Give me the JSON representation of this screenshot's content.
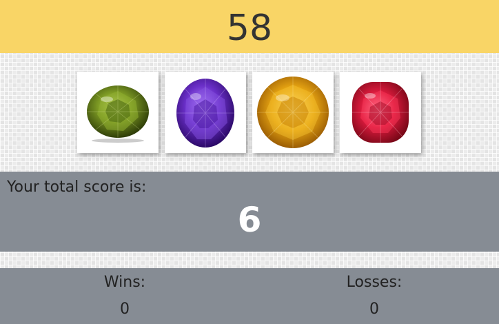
{
  "target": {
    "value": "58"
  },
  "gems": [
    {
      "name": "green-gem-icon",
      "color": "#6b8a1c"
    },
    {
      "name": "purple-gem-icon",
      "color": "#6a2fc8"
    },
    {
      "name": "yellow-gem-icon",
      "color": "#e6a412"
    },
    {
      "name": "red-gem-icon",
      "color": "#d81a3c"
    }
  ],
  "score": {
    "label": "Your total score is:",
    "value": "6"
  },
  "record": {
    "wins_label": "Wins:",
    "wins_value": "0",
    "losses_label": "Losses:",
    "losses_value": "0"
  },
  "colors": {
    "accent": "#f9d566",
    "panel": "#868c94"
  }
}
